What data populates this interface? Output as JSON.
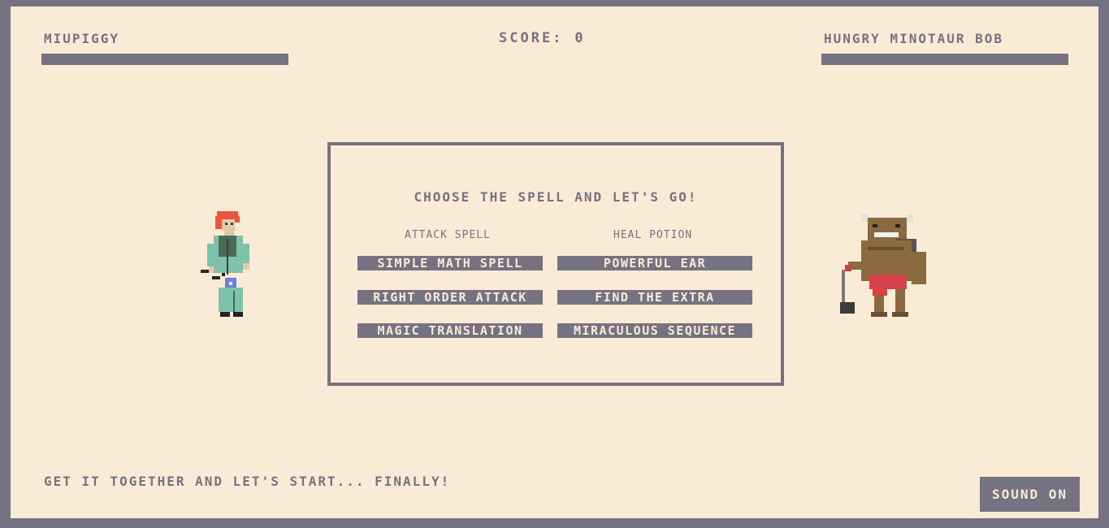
{
  "player": {
    "name": "Miupiggy",
    "health_fraction": 1.0
  },
  "enemy": {
    "name": "Hungry Minotaur Bob",
    "health_fraction": 1.0
  },
  "score": {
    "label": "Score:",
    "value": "0"
  },
  "panel": {
    "title": "Choose the spell and let's go!",
    "attack_header": "Attack spell",
    "heal_header": "Heal potion",
    "attack_spells": [
      "Simple math spell",
      "Right order attack",
      "Magic translation"
    ],
    "heal_potions": [
      "Powerful ear",
      "Find the extra",
      "Miraculous sequence"
    ]
  },
  "message": "Get it together and let's start... finally!",
  "sound_button": "Sound on",
  "colors": {
    "background": "#faebd7",
    "ink": "#757281"
  },
  "icons": {
    "player_sprite": "wizard-sprite",
    "enemy_sprite": "minotaur-sprite"
  }
}
